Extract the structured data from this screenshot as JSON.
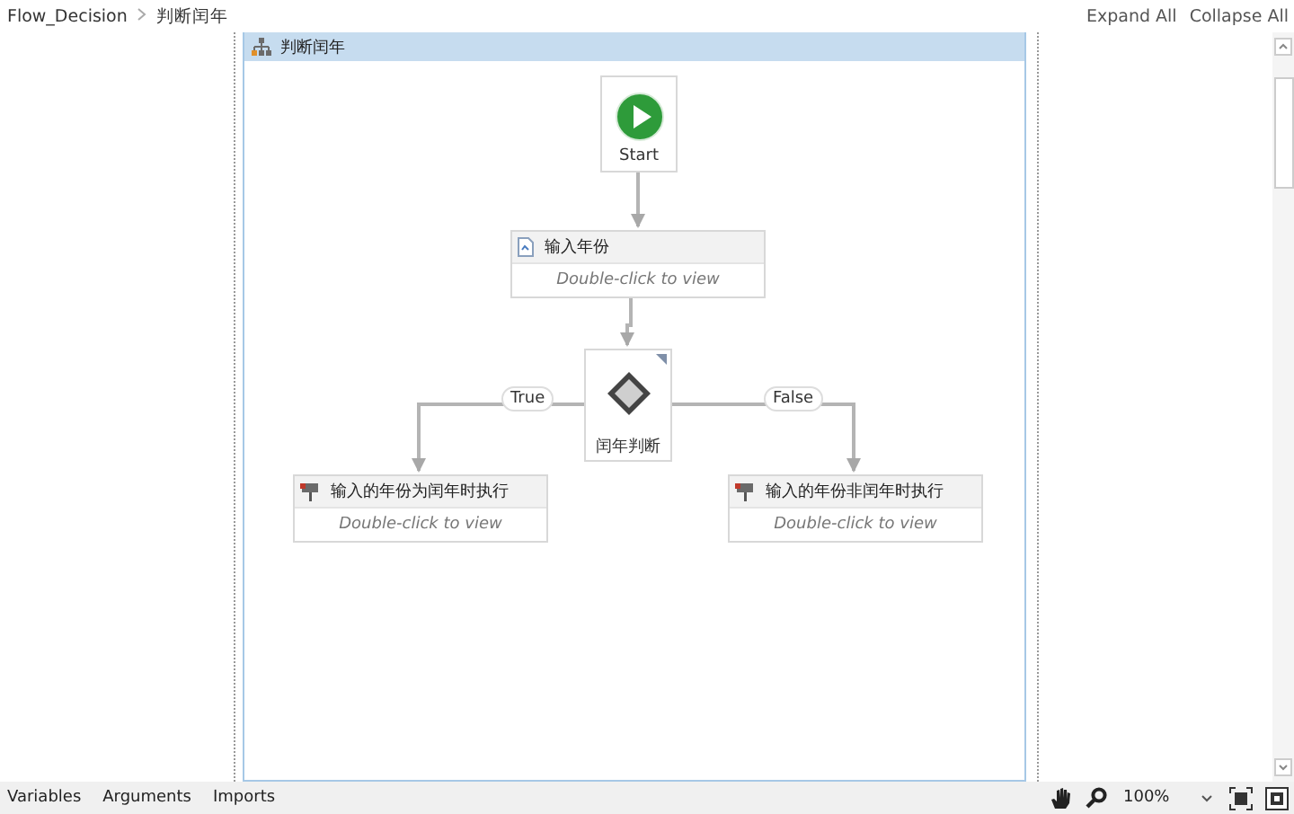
{
  "breadcrumb": [
    "Flow_Decision",
    "判断闰年"
  ],
  "actions": [
    "Expand All",
    "Collapse All"
  ],
  "flowchart": {
    "title": "判断闰年",
    "nodes": [
      {
        "kind": "start",
        "label": "Start"
      },
      {
        "kind": "input",
        "title": "输入年份",
        "hint": "Double-click to view"
      },
      {
        "kind": "decision",
        "label": "闰年判断"
      },
      {
        "kind": "message",
        "title": "输入的年份为闰年时执行",
        "hint": "Double-click to view"
      },
      {
        "kind": "message",
        "title": "输入的年份非闰年时执行",
        "hint": "Double-click to view"
      }
    ],
    "branches": [
      "True",
      "False"
    ]
  },
  "bottom_tabs": [
    "Variables",
    "Arguments",
    "Imports"
  ],
  "zoom": "100%"
}
